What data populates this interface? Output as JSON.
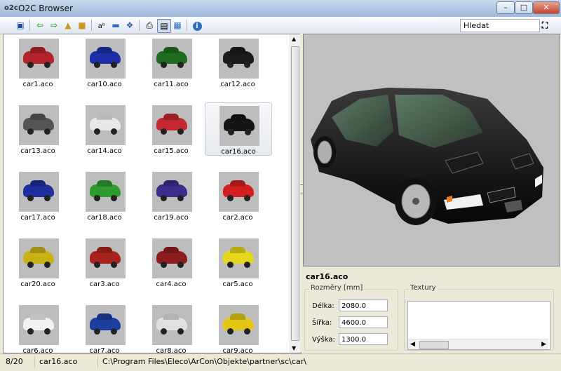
{
  "window": {
    "app_icon": "o2c",
    "title": "O2C Browser",
    "controls": [
      "minimize-icon",
      "maximize-icon",
      "close-icon"
    ]
  },
  "toolbar": {
    "buttons": [
      "view-icon",
      "back-arrow-icon",
      "forward-arrow-icon",
      "folder-up-icon",
      "folder-home-icon",
      "text-size-icon",
      "background-icon",
      "options-icon",
      "print-icon",
      "details-view-icon",
      "thumbnail-view-icon",
      "info-icon"
    ],
    "search_value": "Hledat",
    "search_icon": "binoculars-icon"
  },
  "thumbnails": [
    {
      "label": "car1.aco",
      "color": "#b2232a"
    },
    {
      "label": "car10.aco",
      "color": "#1c2fa8"
    },
    {
      "label": "car11.aco",
      "color": "#1f6b1f"
    },
    {
      "label": "car12.aco",
      "color": "#1a1a1a"
    },
    {
      "label": "car13.aco",
      "color": "#555555"
    },
    {
      "label": "car14.aco",
      "color": "#e8e8e8"
    },
    {
      "label": "car15.aco",
      "color": "#c2282e"
    },
    {
      "label": "car16.aco",
      "color": "#151515"
    },
    {
      "label": "car17.aco",
      "color": "#1e2e9e"
    },
    {
      "label": "car18.aco",
      "color": "#2f9b2f"
    },
    {
      "label": "car19.aco",
      "color": "#3d2c8c"
    },
    {
      "label": "car2.aco",
      "color": "#d21f1f"
    },
    {
      "label": "car20.aco",
      "color": "#c8b316"
    },
    {
      "label": "car3.aco",
      "color": "#a8231c"
    },
    {
      "label": "car4.aco",
      "color": "#8f1c1c"
    },
    {
      "label": "car5.aco",
      "color": "#e6d61c"
    },
    {
      "label": "car6.aco",
      "color": "#f2f2f2"
    },
    {
      "label": "car7.aco",
      "color": "#1d3fa0"
    },
    {
      "label": "car8.aco",
      "color": "#e0e0e0"
    },
    {
      "label": "car9.aco",
      "color": "#e4c714"
    }
  ],
  "selected_index": 7,
  "details": {
    "name": "car16.aco",
    "dimensions_title": "Rozměry [mm]",
    "textures_title": "Textury",
    "rows": [
      {
        "label": "Délka:",
        "value": "2080.0"
      },
      {
        "label": "Šířka:",
        "value": "4600.0"
      },
      {
        "label": "Výška:",
        "value": "1300.0"
      }
    ]
  },
  "status": {
    "count": "8/20",
    "file": "car16.aco",
    "path": "C:\\Program Files\\Eleco\\ArCon\\Objekte\\partner\\sc\\car\\"
  }
}
